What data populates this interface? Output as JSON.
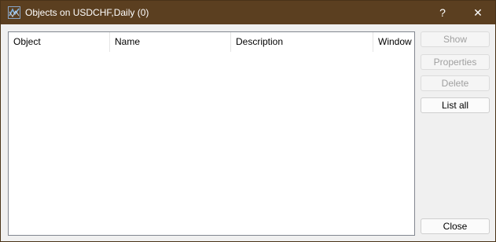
{
  "window": {
    "title": "Objects on USDCHF,Daily (0)",
    "icon": "app-icon",
    "help_label": "?",
    "close_glyph": "✕"
  },
  "table": {
    "columns": [
      "Object",
      "Name",
      "Description",
      "Window"
    ],
    "rows": []
  },
  "buttons": {
    "show": "Show",
    "properties": "Properties",
    "delete": "Delete",
    "list_all": "List all",
    "close": "Close"
  }
}
